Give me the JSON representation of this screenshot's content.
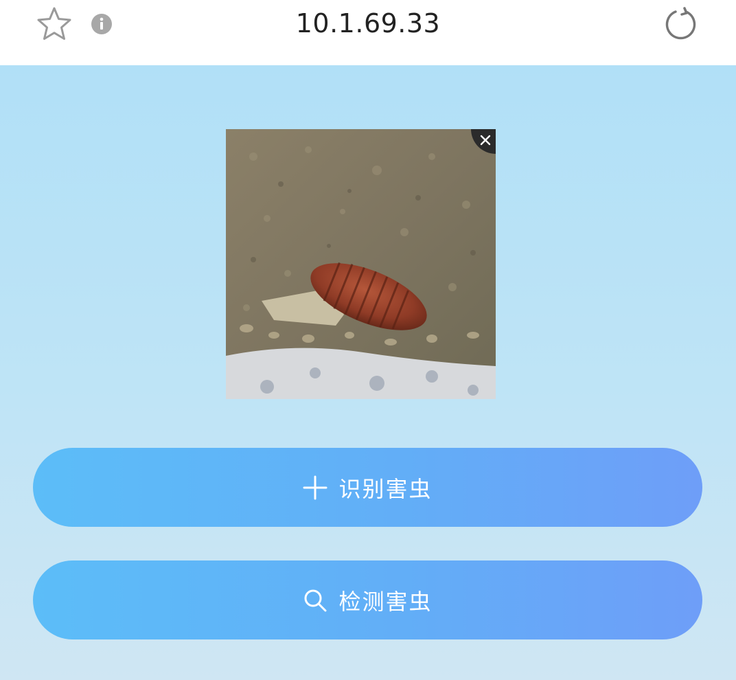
{
  "browser": {
    "url": "10.1.69.33",
    "icons": {
      "bookmark": "star-icon",
      "info": "info-icon",
      "reload": "reload-icon"
    }
  },
  "upload": {
    "image_alt": "insect photo",
    "remove_icon": "close-icon"
  },
  "actions": {
    "identify_label": "识别害虫",
    "identify_icon": "plus-icon",
    "detect_label": "检测害虫",
    "detect_icon": "search-icon"
  },
  "colors": {
    "page_bg": "#b1e0f7",
    "button_start": "#5cbdf8",
    "button_end": "#6e9ef8",
    "text_on_button": "#ffffff"
  }
}
